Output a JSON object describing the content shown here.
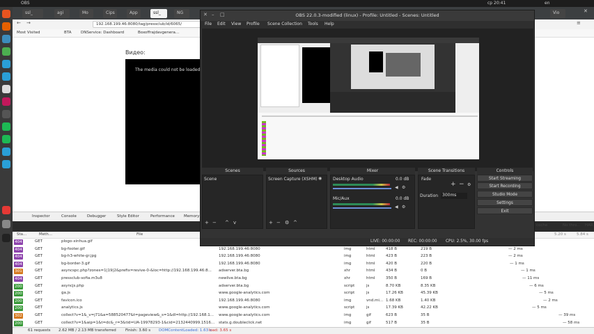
{
  "system": {
    "app_name": "OBS",
    "clock": "cp 20:41",
    "lang": "en"
  },
  "browser": {
    "tabs": [
      {
        "label": "ssl_"
      },
      {
        "label": "agi"
      },
      {
        "label": "Mo"
      },
      {
        "label": "Cips"
      },
      {
        "label": "App"
      },
      {
        "label": "ssl_"
      },
      {
        "label": "NG"
      },
      {
        "label": "Vio"
      }
    ],
    "url": "192.168.199.46:8080/tag/pressclub/id/6065/",
    "bookmarks": [
      "Most Visited",
      "BTA",
      "DNService: Dashboard",
      "Boxoffrajdavgenera..."
    ],
    "page": {
      "video_label": "Видео:",
      "video_message": "The media could not be loaded, e"
    }
  },
  "devtools": {
    "tabs": [
      "Inspector",
      "Console",
      "Debugger",
      "Style Editor",
      "Performance",
      "Memory"
    ],
    "network_headers": [
      "Sta...",
      "Meth...",
      "File",
      "coche",
      "No thro...",
      "HAR"
    ],
    "waterfall_scale": [
      "5.20 s",
      "5.84 s"
    ],
    "rows": [
      {
        "status": "404",
        "method": "GET",
        "file": "plogo-xinhua.gif",
        "domain": "",
        "type": "",
        "ext": "",
        "transferred": "",
        "size": "",
        "timing": ""
      },
      {
        "status": "404",
        "method": "GET",
        "file": "bg-footer.gif",
        "domain": "192.168.199.46:8080",
        "type": "img",
        "ext": "html",
        "transferred": "418 B",
        "size": "219 B",
        "timing": "— 2 ms"
      },
      {
        "status": "404",
        "method": "GET",
        "file": "bg-h3-white-gr.jpg",
        "domain": "192.168.199.46:8080",
        "type": "img",
        "ext": "html",
        "transferred": "423 B",
        "size": "223 B",
        "timing": "— 2 ms"
      },
      {
        "status": "404",
        "method": "GET",
        "file": "bg-border-3.gif",
        "domain": "192.168.199.46:8080",
        "type": "img",
        "ext": "html",
        "transferred": "420 B",
        "size": "220 B",
        "timing": "— 1 ms"
      },
      {
        "status": "301",
        "method": "GET",
        "file": "asyncspc.php?zones=1|19|2&prefix=revive-0-&loc=http://192.168.199.46:8...",
        "domain": "adserver.bta.bg",
        "type": "xhr",
        "ext": "html",
        "transferred": "434 B",
        "size": "0 B",
        "timing": "— 1 ms"
      },
      {
        "status": "404",
        "method": "GET",
        "file": "pressclub-sofia.m3u8",
        "domain": "newlive.bta.bg",
        "type": "xhr",
        "ext": "html",
        "transferred": "350 B",
        "size": "169 B",
        "timing": "— 11 ms"
      },
      {
        "status": "200",
        "method": "GET",
        "file": "asyncjs.php",
        "domain": "adserver.bta.bg",
        "type": "script",
        "ext": "js",
        "transferred": "8.70 KB",
        "size": "8.35 KB",
        "timing": "— 6 ms"
      },
      {
        "status": "200",
        "method": "GET",
        "file": "ga.js",
        "domain": "www.google-analytics.com",
        "type": "script",
        "ext": "js",
        "transferred": "17.26 KB",
        "size": "45.39 KB",
        "timing": "— 5 ms"
      },
      {
        "status": "200",
        "method": "GET",
        "file": "favicon.ico",
        "domain": "192.168.199.46:8080",
        "type": "img",
        "ext": "vnd.mi...",
        "transferred": "1.68 KB",
        "size": "1.40 KB",
        "timing": "— 2 ms"
      },
      {
        "status": "200",
        "method": "GET",
        "file": "analytics.js",
        "domain": "www.google-analytics.com",
        "type": "script",
        "ext": "js",
        "transferred": "17.39 KB",
        "size": "42.22 KB",
        "timing": "— 5 ms"
      },
      {
        "status": "302",
        "method": "GET",
        "file": "collect?v=1&_v=j71&a=588520477&t=pageview&_s=1&dl=http://192.168.1...",
        "domain": "www.google-analytics.com",
        "type": "img",
        "ext": "gif",
        "transferred": "623 B",
        "size": "35 B",
        "timing": "— 39 ms"
      },
      {
        "status": "200",
        "method": "GET",
        "file": "collect?v=1&aip=1&t=dc&_r=3&tid=UA-19978293-1&cid=2132440999.1516...",
        "domain": "stats.g.doubleclick.net",
        "type": "img",
        "ext": "gif",
        "transferred": "517 B",
        "size": "35 B",
        "timing": "— 58 ms"
      }
    ],
    "status": {
      "requests": "61 requests",
      "transferred": "2.62 MB / 2.13 MB transferred",
      "finish": "Finish: 3.60 s",
      "dom": "DOMContentLoaded: 1.63 s",
      "load": "load: 3.65 s"
    }
  },
  "obs": {
    "title": "OBS 22.0.3-modified (linux) - Profile: Untitled - Scenes: Untitled",
    "menu": [
      "File",
      "Edit",
      "View",
      "Profile",
      "Scene Collection",
      "Tools",
      "Help"
    ],
    "docks": {
      "scenes": {
        "title": "Scenes",
        "items": [
          "Scene"
        ]
      },
      "sources": {
        "title": "Sources",
        "items": [
          "Screen Capture (XSHM)"
        ]
      },
      "mixer": {
        "title": "Mixer",
        "channels": [
          {
            "name": "Desktop Audio",
            "level": "0.0 dB"
          },
          {
            "name": "Mic/Aux",
            "level": "0.0 dB"
          }
        ]
      },
      "transitions": {
        "title": "Scene Transitions",
        "type": "Fade",
        "duration_label": "Duration",
        "duration_value": "300ms"
      },
      "controls": {
        "title": "Controls",
        "buttons": [
          "Start Streaming",
          "Start Recording",
          "Studio Mode",
          "Settings",
          "Exit"
        ]
      }
    },
    "status": {
      "live": "LIVE: 00:00:00",
      "rec": "REC: 00:00:00",
      "cpu": "CPU: 2.5%, 30.00 fps"
    }
  }
}
